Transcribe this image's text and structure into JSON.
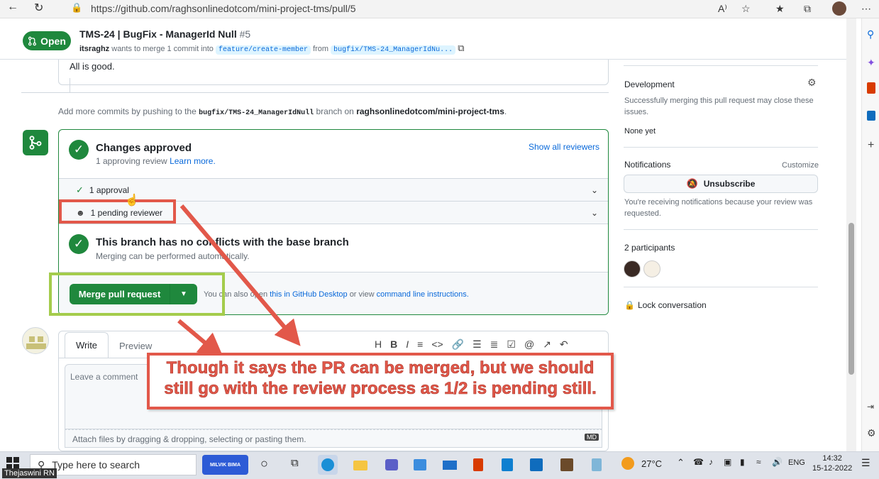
{
  "browser": {
    "url": "https://github.com/raghsonlinedotcom/mini-project-tms/pull/5"
  },
  "pr": {
    "status_label": "Open",
    "title": "TMS-24 | BugFix - ManagerId Null",
    "number": "#5",
    "author": "itsraghz",
    "merge_text": "wants to merge 1 commit into",
    "base_branch": "feature/create-member",
    "from_word": "from",
    "head_branch": "bugfix/TMS-24_ManagerIdNu..."
  },
  "timeline": {
    "comment_text": "All is good.",
    "add_more_prefix": "Add more commits by pushing to the",
    "add_more_branch": "bugfix/TMS-24_ManagerIdNull",
    "add_more_mid": "branch on",
    "add_more_repo": "raghsonlinedotcom/mini-project-tms",
    "add_more_suffix": "."
  },
  "merge_box": {
    "approved_title": "Changes approved",
    "approved_sub": "1 approving review",
    "learn_more": "Learn more.",
    "show_all_reviewers": "Show all reviewers",
    "approval_row": "1 approval",
    "pending_row": "1 pending reviewer",
    "conflicts_title": "This branch has no conflicts with the base branch",
    "conflicts_sub": "Merging can be performed automatically.",
    "merge_button": "Merge pull request",
    "also_prefix": "You can also open",
    "desktop_link": "this in GitHub Desktop",
    "or_view": "or view",
    "cli_link": "command line instructions."
  },
  "composer": {
    "tab_write": "Write",
    "tab_preview": "Preview",
    "placeholder": "Leave a comment",
    "attach_hint": "Attach files by dragging & dropping, selecting or pasting them.",
    "markdown_badge": "MD"
  },
  "sidebar": {
    "development_heading": "Development",
    "development_text": "Successfully merging this pull request may close these issues.",
    "development_none": "None yet",
    "notifications_heading": "Notifications",
    "customize": "Customize",
    "unsubscribe": "Unsubscribe",
    "notifications_text": "You're receiving notifications because your review was requested.",
    "participants_heading": "2 participants",
    "lock": "Lock conversation"
  },
  "annotation": {
    "callout": "Though it says the PR can be merged, but we should still go with the review process as 1/2 is pending still."
  },
  "taskbar": {
    "search_placeholder": "Type here to search",
    "pinned_app": "MILVIK BIMA",
    "temperature": "27°C",
    "language": "ENG",
    "time": "14:32",
    "date": "15-12-2022",
    "user_label": "Thejaswini RN"
  },
  "colors": {
    "accent_green": "#1f883d",
    "link_blue": "#0969da",
    "annotation_red": "#e2584a",
    "annotation_green": "#a4cc4c"
  }
}
